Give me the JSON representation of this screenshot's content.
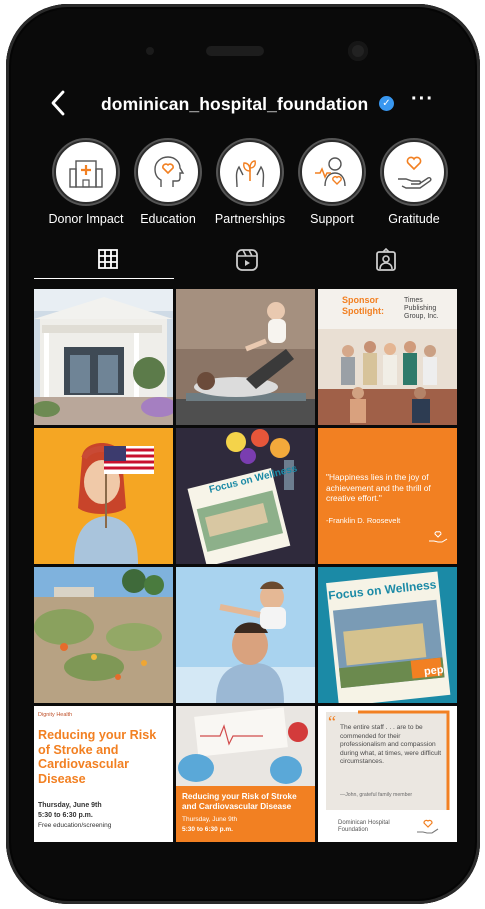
{
  "header": {
    "back_label": "‹",
    "handle": "dominican_hospital_foundation",
    "verified_icon": "verified-badge-icon",
    "more_label": "···"
  },
  "highlights": [
    {
      "label": "Donor Impact",
      "icon": "hospital-icon"
    },
    {
      "label": "Education",
      "icon": "head-heart-icon"
    },
    {
      "label": "Partnerships",
      "icon": "hands-plant-icon"
    },
    {
      "label": "Support",
      "icon": "person-heartbeat-icon"
    },
    {
      "label": "Gratitude",
      "icon": "hand-heart-icon"
    }
  ],
  "tabs": [
    {
      "name": "grid-icon",
      "active": true
    },
    {
      "name": "reels-icon",
      "active": false
    },
    {
      "name": "tagged-icon",
      "active": false
    }
  ],
  "posts": {
    "sponsor": {
      "title": "Sponsor Spotlight:",
      "company": "Times Publishing Group, Inc."
    },
    "quote1": {
      "quote": "\"Happiness lies in the joy of achievement and the thrill of creative effort.\"",
      "author": "-Franklin D. Roosevelt"
    },
    "magazine": {
      "title": "Focus on Wellness",
      "badge": "pep"
    },
    "stroke1": {
      "org": "Dignity Health",
      "title": "Reducing your Risk of Stroke and Cardiovascular Disease",
      "date": "Thursday, June 9th",
      "time": "5:30 to 6:30 p.m.",
      "note": "Free education/screening"
    },
    "stroke2": {
      "title": "Reducing your Risk of Stroke and Cardiovascular Disease",
      "date": "Thursday, June 9th",
      "time": "5:30 to 6:30 p.m."
    },
    "quote2": {
      "quote": "The entire staff . . . are to be commended for their professionalism and compassion during what, at times, were difficult circumstances.",
      "author": "—John, grateful family member",
      "org": "Dominican Hospital Foundation"
    }
  },
  "colors": {
    "brand_orange": "#f28022",
    "verified_blue": "#3897f0",
    "teal": "#1b8aa6"
  }
}
